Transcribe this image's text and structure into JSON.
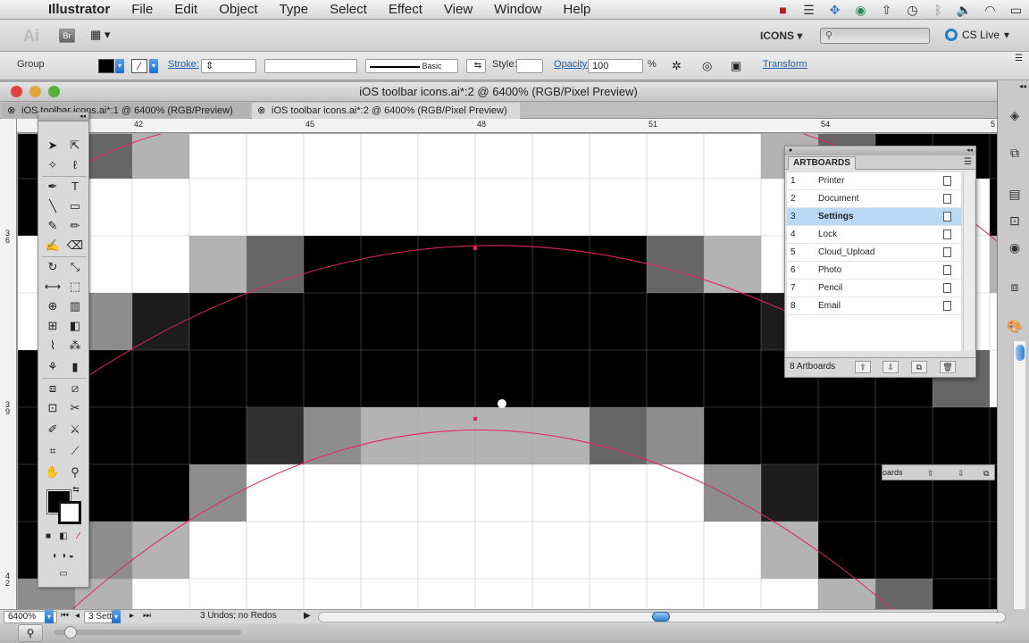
{
  "menubar": {
    "app_name": "Illustrator",
    "items": [
      "File",
      "Edit",
      "Object",
      "Type",
      "Select",
      "Effect",
      "View",
      "Window",
      "Help"
    ]
  },
  "appbar": {
    "logo": "Ai",
    "bridge": "Br",
    "workspace": "ICONS",
    "search_placeholder": "",
    "cs_live": "CS Live"
  },
  "control_bar": {
    "selection": "Group",
    "stroke_label": "Stroke:",
    "brush": "Basic",
    "style_label": "Style:",
    "opacity_label": "Opacity:",
    "opacity_value": "100",
    "opacity_unit": "%",
    "transform_link": "Transform"
  },
  "document": {
    "title": "iOS toolbar icons.ai*:2 @ 6400% (RGB/Pixel Preview)",
    "tabs": [
      {
        "label": "iOS toolbar icons.ai*:1 @ 6400% (RGB/Preview)"
      },
      {
        "label": "iOS toolbar icons.ai*:2 @ 6400% (RGB/Pixel Preview)"
      }
    ],
    "ruler_h": [
      "42",
      "45",
      "48",
      "51",
      "54",
      "5"
    ],
    "ruler_v": [
      "3\n6",
      "3\n9",
      "4\n2"
    ]
  },
  "artboards_panel": {
    "title": "ARTBOARDS",
    "rows": [
      {
        "num": "1",
        "name": "Printer"
      },
      {
        "num": "2",
        "name": "Document"
      },
      {
        "num": "3",
        "name": "Settings",
        "selected": true
      },
      {
        "num": "4",
        "name": "Lock"
      },
      {
        "num": "5",
        "name": "Cloud_Upload"
      },
      {
        "num": "6",
        "name": "Photo"
      },
      {
        "num": "7",
        "name": "Pencil"
      },
      {
        "num": "8",
        "name": "Email"
      }
    ],
    "footer": "8 Artboards",
    "collapsed_label": "oards"
  },
  "statusbar": {
    "zoom": "6400%",
    "artboard": "3 Sett",
    "status": "3 Undos; no Redos"
  },
  "colors": {
    "accent": "#1e7ec8",
    "selection_row": "#b9d9f7",
    "guide": "#e4245a"
  }
}
